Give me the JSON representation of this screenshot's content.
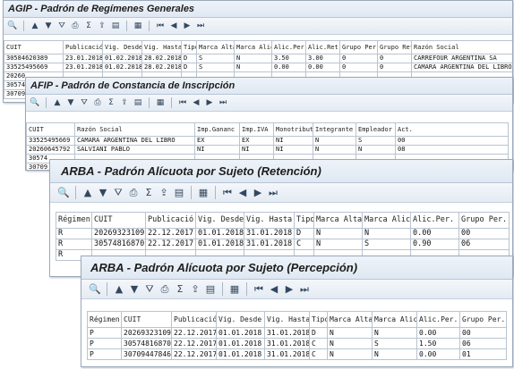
{
  "windows": [
    {
      "title": "AGIP - Padrón de Regímenes Generales",
      "columns": [
        "CUIT",
        "Publicació",
        "Vig. Desde",
        "Vig. Hasta",
        "Tipo",
        "Marca Alta",
        "Marca Alic",
        "Alic.Per.",
        "Alic.Ret.",
        "Grupo Per.",
        "Grupo Ret",
        "Razón Social"
      ],
      "rows": [
        [
          "30584620389",
          "23.01.2018",
          "01.02.2018",
          "28.02.2018",
          "D",
          "S",
          "N",
          "3.50",
          "3.00",
          "0",
          "0",
          "CARREFOUR ARGENTINA SA"
        ],
        [
          "33525495669",
          "23.01.2018",
          "01.02.2018",
          "28.02.2018",
          "D",
          "S",
          "N",
          "0.00",
          "0.00",
          "0",
          "0",
          "CAMARA ARGENTINA DEL LIBRO"
        ],
        [
          "20260",
          "",
          "",
          "",
          "",
          "",
          "",
          "",
          "",
          "",
          "",
          ""
        ],
        [
          "30574",
          "",
          "",
          "",
          "",
          "",
          "",
          "",
          "",
          "",
          "",
          ""
        ],
        [
          "30709",
          "",
          "",
          "",
          "",
          "",
          "",
          "",
          "",
          "",
          "",
          ""
        ]
      ]
    },
    {
      "title": "AFIP - Padrón de Constancia de Inscripción",
      "columns": [
        "CUIT",
        "Razón Social",
        "Imp.Gananc",
        "Imp.IVA",
        "Monotribut",
        "Integrante",
        "Empleador",
        "Act."
      ],
      "rows": [
        [
          "33525495669",
          "CAMARA ARGENTINA DEL LIBRO",
          "EX",
          "EX",
          "NI",
          "N",
          "S",
          "00"
        ],
        [
          "20260645792",
          "SALVIANI PABLO",
          "NI",
          "NI",
          "NI",
          "N",
          "N",
          "08"
        ],
        [
          "30574",
          "",
          "",
          "",
          "",
          "",
          "",
          ""
        ],
        [
          "30709",
          "",
          "",
          "",
          "",
          "",
          "",
          ""
        ]
      ]
    },
    {
      "title": "ARBA - Padrón Alícuota por Sujeto (Retención)",
      "columns": [
        "Régimen",
        "CUIT",
        "Publicació",
        "Vig. Desde",
        "Vig. Hasta",
        "Tipo",
        "Marca Alta",
        "Marca Alic",
        "Alic.Per.",
        "Grupo Per."
      ],
      "rows": [
        [
          "R",
          "20269323109",
          "22.12.2017",
          "01.01.2018",
          "31.01.2018",
          "D",
          "N",
          "N",
          "0.00",
          "00"
        ],
        [
          "R",
          "30574816870",
          "22.12.2017",
          "01.01.2018",
          "31.01.2018",
          "C",
          "N",
          "S",
          "0.90",
          "06"
        ],
        [
          "R",
          "",
          "",
          "",
          "",
          "",
          "",
          "",
          "",
          ""
        ]
      ]
    },
    {
      "title": "ARBA - Padrón Alícuota por Sujeto (Percepción)",
      "columns": [
        "Régimen",
        "CUIT",
        "Publicació",
        "Vig. Desde",
        "Vig. Hasta",
        "Tipo",
        "Marca Alta",
        "Marca Alic",
        "Alic.Per.",
        "Grupo Per."
      ],
      "rows": [
        [
          "P",
          "20269323109",
          "22.12.2017",
          "01.01.2018",
          "31.01.2018",
          "D",
          "N",
          "N",
          "0.00",
          "00"
        ],
        [
          "P",
          "30574816870",
          "22.12.2017",
          "01.01.2018",
          "31.01.2018",
          "C",
          "N",
          "S",
          "1.50",
          "06"
        ],
        [
          "P",
          "30709447846",
          "22.12.2017",
          "01.01.2018",
          "31.01.2018",
          "C",
          "N",
          "N",
          "0.00",
          "01"
        ]
      ]
    }
  ],
  "toolbar_icons": [
    "details-icon",
    "sort-ascending-icon",
    "sort-descending-icon",
    "filter-icon",
    "print-preview-icon",
    "sum-icon",
    "export-icon",
    "layout-icon",
    "spreadsheet-icon",
    "first-page-icon",
    "previous-page-icon",
    "next-page-icon",
    "last-page-icon"
  ]
}
